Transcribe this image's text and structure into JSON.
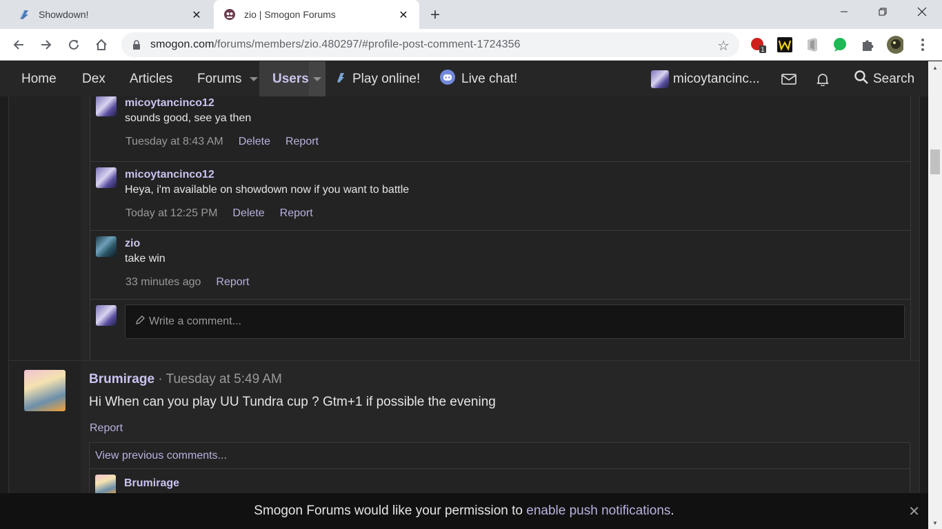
{
  "browser": {
    "tabs": [
      {
        "title": "Showdown!",
        "icon": "showdown-favicon"
      },
      {
        "title": "zio | Smogon Forums",
        "icon": "smogon-favicon"
      }
    ],
    "url_host": "smogon.com",
    "url_path": "/forums/members/zio.480297/#profile-post-comment-1724356",
    "extension_badge": "1"
  },
  "nav": {
    "home": "Home",
    "dex": "Dex",
    "articles": "Articles",
    "forums": "Forums",
    "users": "Users",
    "play_online": "Play online!",
    "live_chat": "Live chat!",
    "account": "micoytancinc...",
    "search": "Search"
  },
  "comments": [
    {
      "author": "micoytancinco12",
      "text": "sounds good, see ya then",
      "time": "Tuesday at 8:43 AM",
      "actions": [
        "Delete",
        "Report"
      ]
    },
    {
      "author": "micoytancinco12",
      "text": "Heya, i'm available on showdown now if you want to battle",
      "time": "Today at 12:25 PM",
      "actions": [
        "Delete",
        "Report"
      ]
    },
    {
      "author": "zio",
      "text": "take win",
      "time": "33 minutes ago",
      "actions": [
        "Report"
      ]
    }
  ],
  "write_comment_placeholder": "Write a comment...",
  "post": {
    "author": "Brumirage",
    "separator": "·",
    "time": "Tuesday at 5:49 AM",
    "text": "Hi When can you play UU Tundra cup ? Gtm+1 if possible the evening",
    "report": "Report",
    "view_previous": "View previous comments...",
    "first_comment_author": "Brumirage"
  },
  "notice": {
    "prefix": "Smogon Forums would like your permission to",
    "link": "enable push notifications",
    "suffix": "."
  },
  "colors": {
    "accent": "#c9c4ef",
    "link": "#b7b2e0",
    "background": "#1d1d1d",
    "nav": "#262626"
  }
}
